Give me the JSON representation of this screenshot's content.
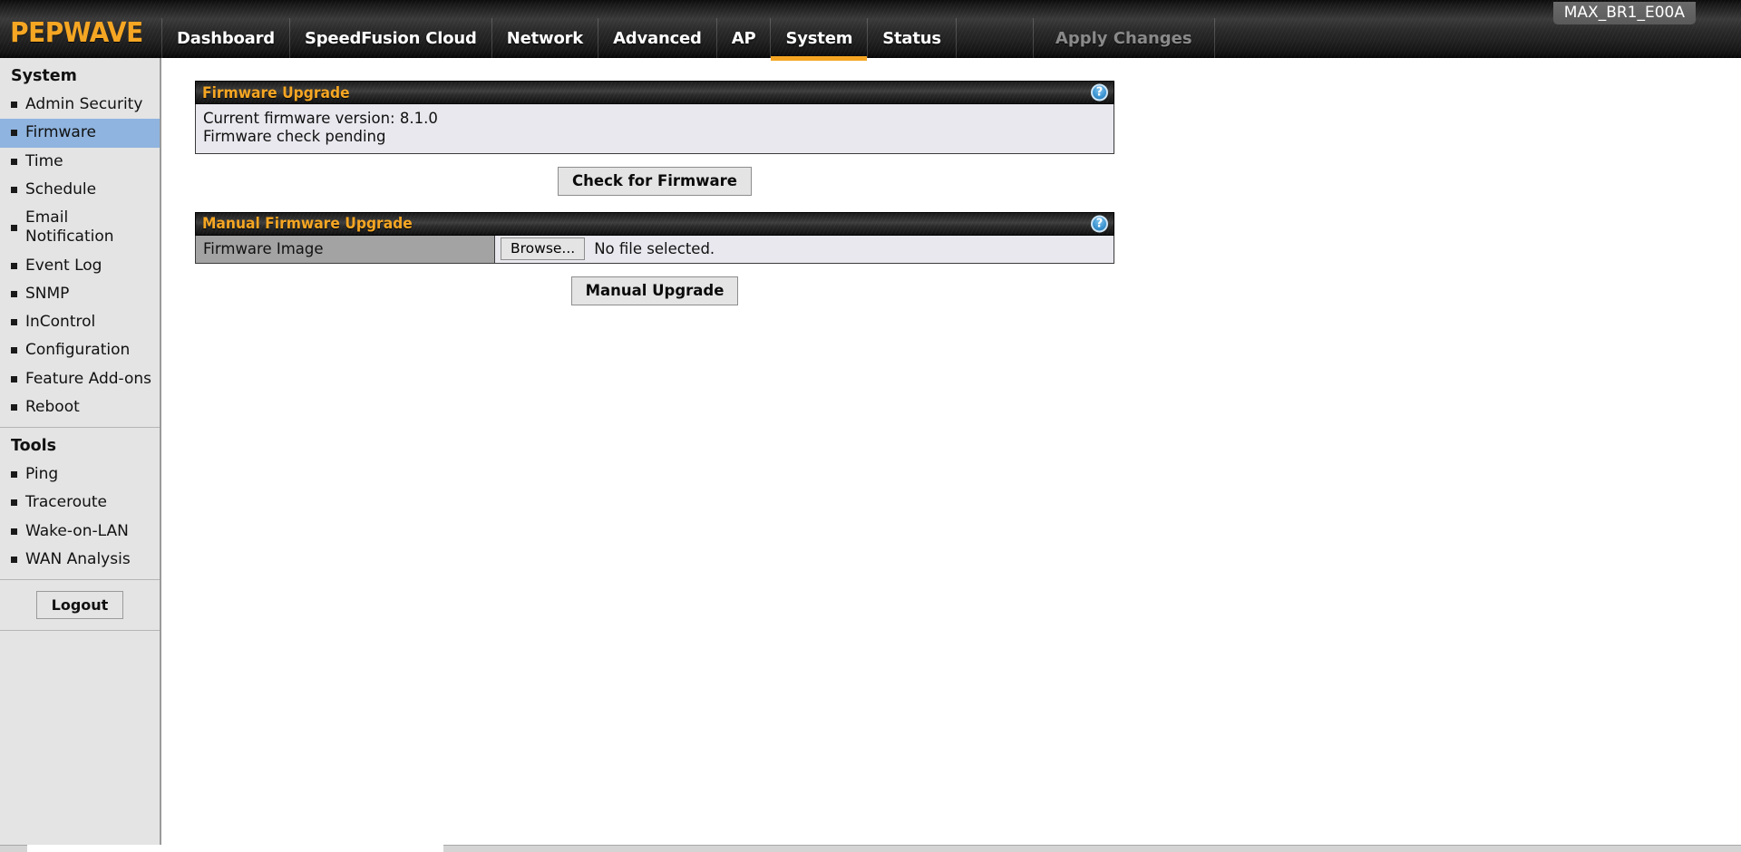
{
  "topbar": {
    "logo": "PEPWAVE",
    "nav": [
      {
        "label": "Dashboard",
        "active": false
      },
      {
        "label": "SpeedFusion Cloud",
        "active": false
      },
      {
        "label": "Network",
        "active": false
      },
      {
        "label": "Advanced",
        "active": false
      },
      {
        "label": "AP",
        "active": false
      },
      {
        "label": "System",
        "active": true
      },
      {
        "label": "Status",
        "active": false
      }
    ],
    "apply_changes_label": "Apply Changes",
    "device_tag": "MAX_BR1_E00A",
    "accent_color": "#f5a623"
  },
  "sidebar": {
    "groups": [
      {
        "title": "System",
        "items": [
          {
            "label": "Admin Security",
            "selected": false
          },
          {
            "label": "Firmware",
            "selected": true
          },
          {
            "label": "Time",
            "selected": false
          },
          {
            "label": "Schedule",
            "selected": false
          },
          {
            "label": "Email Notification",
            "selected": false
          },
          {
            "label": "Event Log",
            "selected": false
          },
          {
            "label": "SNMP",
            "selected": false
          },
          {
            "label": "InControl",
            "selected": false
          },
          {
            "label": "Configuration",
            "selected": false
          },
          {
            "label": "Feature Add-ons",
            "selected": false
          },
          {
            "label": "Reboot",
            "selected": false
          }
        ]
      },
      {
        "title": "Tools",
        "items": [
          {
            "label": "Ping",
            "selected": false
          },
          {
            "label": "Traceroute",
            "selected": false
          },
          {
            "label": "Wake-on-LAN",
            "selected": false
          },
          {
            "label": "WAN Analysis",
            "selected": false
          }
        ]
      }
    ],
    "logout_label": "Logout",
    "selected_color": "#8fb4df"
  },
  "main": {
    "firmware_upgrade": {
      "panel_title": "Firmware Upgrade",
      "help_icon": "question-mark-icon",
      "current_version_line": "Current firmware version: 8.1.0",
      "status_line": "Firmware check pending",
      "check_button_label": "Check for Firmware"
    },
    "manual_firmware_upgrade": {
      "panel_title": "Manual Firmware Upgrade",
      "help_icon": "question-mark-icon",
      "field_label": "Firmware Image",
      "browse_button_label": "Browse...",
      "file_status": "No file selected.",
      "upgrade_button_label": "Manual Upgrade"
    }
  }
}
